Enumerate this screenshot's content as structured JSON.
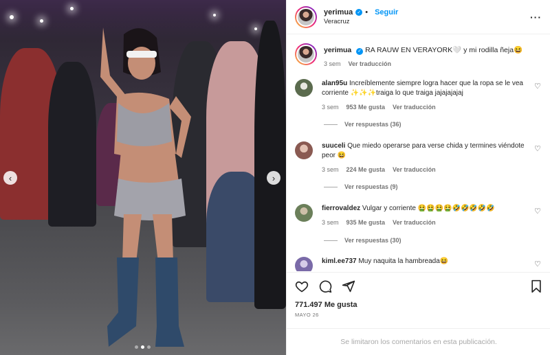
{
  "post": {
    "username": "yerimua",
    "follow_label": "Seguir",
    "location": "Veracruz",
    "caption": "RA RAUW EN VERAYORK🤍 y mi rodilla ñeja😆",
    "caption_time": "3 sem",
    "see_translation": "Ver traducción",
    "likes": "771.497 Me gusta",
    "date": "MAYO 26",
    "comments_limited": "Se limitaron los comentarios en esta publicación.",
    "more_icon": "more-horizontal-icon"
  },
  "comments": [
    {
      "username": "alan95u",
      "text": "Increíblemente siempre logra hacer que la ropa se le vea corriente ✨✨✨traiga lo que traiga jajajajajaj",
      "time": "3 sem",
      "likes": "953 Me gusta",
      "translate": "Ver traducción",
      "replies": "Ver respuestas (36)",
      "avatar_color": "#5b6b4e"
    },
    {
      "username": "suuceli",
      "text": "Que miedo operarse para verse chida y termines viéndote peor 😆",
      "time": "3 sem",
      "likes": "224 Me gusta",
      "translate": "Ver traducción",
      "replies": "Ver respuestas (9)",
      "avatar_color": "#b88a80"
    },
    {
      "username": "fierrovaldez",
      "text": "Vulgar y corriente 🤮🤮🤮🤮🤣🤣🤣🤣🤣",
      "time": "3 sem",
      "likes": "935 Me gusta",
      "translate": "Ver traducción",
      "replies": "Ver respuestas (30)",
      "avatar_color": "#6b7f5a"
    },
    {
      "username": "kiml.ee737",
      "text": "Muy naquita la hambreada😆",
      "avatar_color": "#7a6aa8"
    }
  ],
  "colors": {
    "accent": "#0095f6",
    "secondary_text": "#737373",
    "divider": "#efefef"
  },
  "media": {
    "prev_icon": "chevron-left-icon",
    "next_icon": "chevron-right-icon"
  }
}
